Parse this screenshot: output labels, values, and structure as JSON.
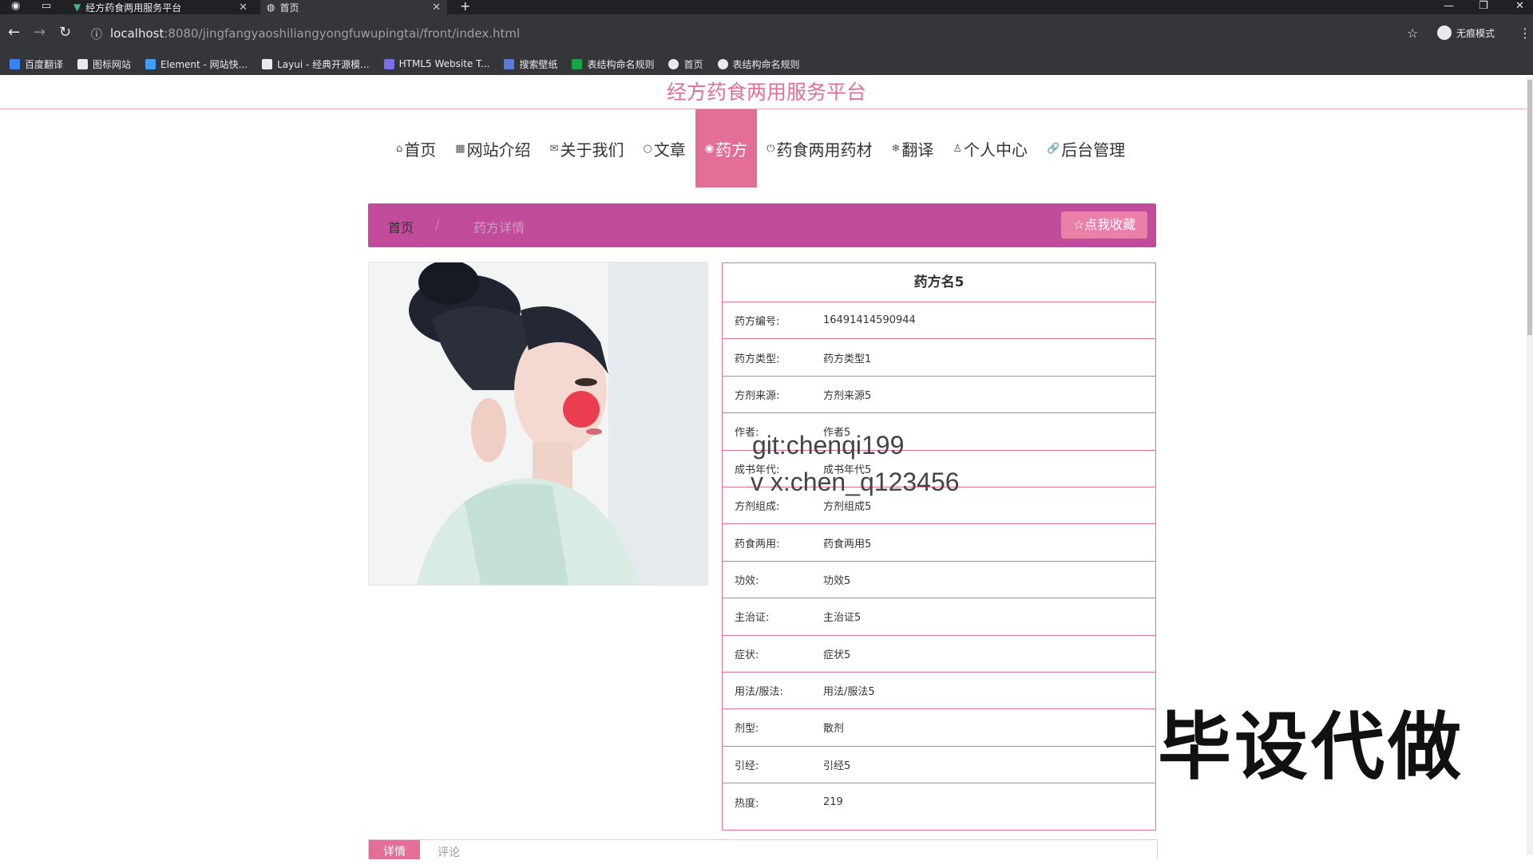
{
  "browser": {
    "tabs": [
      {
        "title": "经方药食两用服务平台"
      },
      {
        "title": "首页"
      }
    ],
    "url_host": "localhost",
    "url_rest": ":8080/jingfangyaoshiliangyongfuwupingtai/front/index.html",
    "incognito_label": "无痕模式",
    "bookmarks": [
      {
        "label": "百度翻译",
        "color": "#3b82f6"
      },
      {
        "label": "图标网站",
        "color": "#e8eaed"
      },
      {
        "label": "Element - 网站快...",
        "color": "#409eff"
      },
      {
        "label": "Layui - 经典开源模...",
        "color": "#e8eaed"
      },
      {
        "label": "HTML5 Website T...",
        "color": "#7c6cf0"
      },
      {
        "label": "搜索壁纸",
        "color": "#5b7bd6"
      },
      {
        "label": "表结构命名规则",
        "color": "#16a34a"
      },
      {
        "label": "首页",
        "color": "#e8eaed"
      },
      {
        "label": "表结构命名规则",
        "color": "#e8eaed"
      }
    ]
  },
  "site": {
    "title": "经方药食两用服务平台",
    "nav": [
      {
        "icon": "⌂",
        "label": "首页"
      },
      {
        "icon": "▦",
        "label": "网站介绍"
      },
      {
        "icon": "✉",
        "label": "关于我们"
      },
      {
        "icon": "○",
        "label": "文章"
      },
      {
        "icon": "◉",
        "label": "药方"
      },
      {
        "icon": "⏻",
        "label": "药食两用药材"
      },
      {
        "icon": "❄",
        "label": "翻译"
      },
      {
        "icon": "♙",
        "label": "个人中心"
      },
      {
        "icon": "🔗",
        "label": "后台管理"
      }
    ],
    "active_nav": "药方"
  },
  "breadcrumb": {
    "home": "首页",
    "separator": "/",
    "current": "药方详情"
  },
  "favorite_button": "☆点我收藏",
  "recipe": {
    "name": "药方名5",
    "fields": [
      {
        "label": "药方编号:",
        "value": "16491414590944"
      },
      {
        "label": "药方类型:",
        "value": "药方类型1"
      },
      {
        "label": "方剂来源:",
        "value": "方剂来源5"
      },
      {
        "label": "作者:",
        "value": "作者5"
      },
      {
        "label": "成书年代:",
        "value": "成书年代5"
      },
      {
        "label": "方剂组成:",
        "value": "方剂组成5"
      },
      {
        "label": "药食两用:",
        "value": "药食两用5"
      },
      {
        "label": "功效:",
        "value": "功效5"
      },
      {
        "label": "主治证:",
        "value": "主治证5"
      },
      {
        "label": "症状:",
        "value": "症状5"
      },
      {
        "label": "用法/服法:",
        "value": "用法/服法5"
      },
      {
        "label": "剂型:",
        "value": "散剂"
      },
      {
        "label": "引经:",
        "value": "引经5"
      },
      {
        "label": "热度:",
        "value": "219"
      }
    ]
  },
  "bottom_tabs": [
    "详情",
    "评论"
  ],
  "overlay": {
    "watermark_line1": "git:chenqi199",
    "watermark_line2": "v x:chen_q123456",
    "big_text": "毕设代做"
  }
}
